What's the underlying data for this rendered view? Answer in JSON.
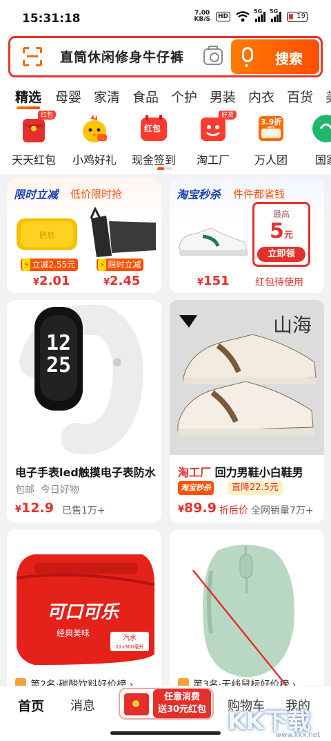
{
  "status": {
    "time": "15:31:18",
    "net_speed": "7.00",
    "net_unit": "KB/S",
    "hd": "HD",
    "sig1": "5G",
    "sig2": "5G",
    "battery": "19"
  },
  "search": {
    "query": "直筒休闲修身牛仔裤",
    "button": "搜索"
  },
  "categories": [
    "精选",
    "母婴",
    "家清",
    "食品",
    "个护",
    "男装",
    "内衣",
    "百货",
    "美"
  ],
  "quick": [
    {
      "label": "天天红包",
      "tag": "红包",
      "color": "#e4302b"
    },
    {
      "label": "小鸡好礼",
      "tag": "",
      "color": "#ffc400"
    },
    {
      "label": "现金签到",
      "tag": "红包",
      "color": "#ff3b30"
    },
    {
      "label": "淘工厂",
      "tag": "好货",
      "color": "#ff3b30"
    },
    {
      "label": "万人团",
      "tag": "3.9折起",
      "color": "#ff6a00"
    },
    {
      "label": "国家",
      "tag": "",
      "color": "#1fb86a"
    }
  ],
  "promo_left": {
    "title": "限时立减",
    "sub": "低价限时抢",
    "badge1": "立减2.55元",
    "badge2": "限时立减",
    "price1": "2.01",
    "price2": "2.45"
  },
  "promo_right": {
    "title": "淘宝秒杀",
    "sub": "件件都省钱",
    "price": "151",
    "coupon_top": "最高",
    "coupon_val": "5",
    "coupon_unit": "元",
    "coupon_btn": "立即领",
    "coupon_cap": "红包待使用"
  },
  "product1": {
    "name": "电子手表led触摸电子表防水",
    "meta1": "包邮",
    "meta2": "今日好物",
    "price": "12.9",
    "sold": "已售1万+"
  },
  "product2": {
    "shop": "淘工厂",
    "name": "回力男鞋小白鞋男",
    "badge": "淘宝秒杀",
    "drop": "直降22.5元",
    "price": "89.9",
    "tag": "折后价",
    "sold": "全网销量7万+"
  },
  "product3": {
    "rank": "第2名·碳酸饮料好价榜",
    "brand": "可口可乐",
    "sub": "经典美味",
    "water": "汽水",
    "spec": "12x300毫升"
  },
  "product4": {
    "rank": "第3名·无线鼠标好价榜"
  },
  "nav": {
    "home": "首页",
    "msg": "消息",
    "promo1": "任意消费",
    "promo2": "送30元红包",
    "cart": "购物车",
    "me": "我的"
  },
  "watermark": {
    "main": "KK下载",
    "sub": "www.kkx.net"
  }
}
